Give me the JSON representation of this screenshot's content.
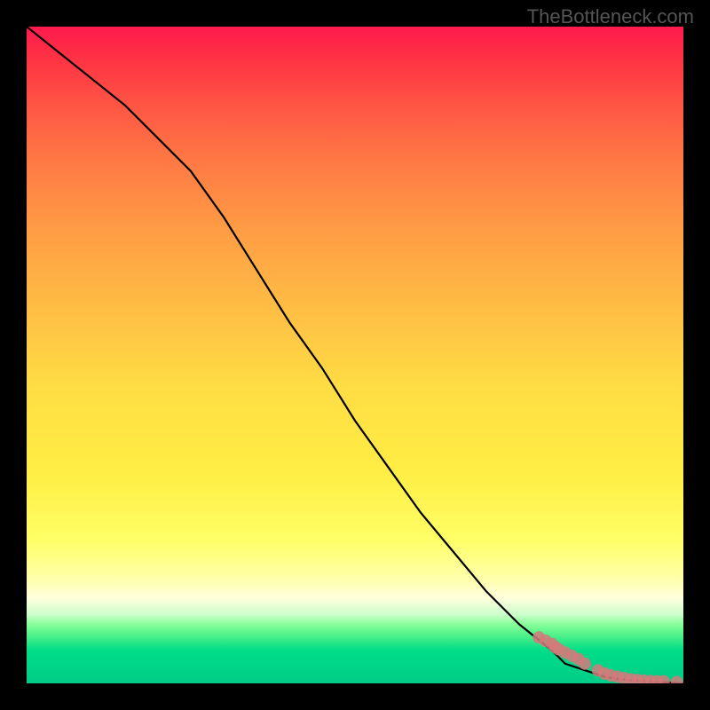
{
  "watermark": "TheBottleneck.com",
  "chart_data": {
    "type": "line",
    "title": "",
    "xlabel": "",
    "ylabel": "",
    "xlim": [
      0,
      100
    ],
    "ylim": [
      0,
      100
    ],
    "grid": false,
    "legend": false,
    "series": [
      {
        "name": "curve",
        "style": "line",
        "color": "#000000",
        "x": [
          0,
          5,
          10,
          15,
          20,
          25,
          30,
          35,
          40,
          45,
          50,
          55,
          60,
          65,
          70,
          75,
          80,
          82,
          85,
          88,
          90,
          92,
          95,
          100
        ],
        "values": [
          100,
          96,
          92,
          88,
          83,
          78,
          71,
          63,
          55,
          48,
          40,
          33,
          26,
          20,
          14,
          9,
          5,
          3,
          2,
          1,
          0.7,
          0.5,
          0.3,
          0
        ]
      },
      {
        "name": "markers",
        "style": "scatter",
        "color": "#d47a7a",
        "x": [
          78,
          79,
          80,
          80.5,
          81,
          82,
          83,
          84,
          85,
          87,
          88,
          89,
          90,
          91,
          92,
          93,
          94,
          95,
          96,
          97,
          99
        ],
        "values": [
          7,
          6.5,
          6,
          5.5,
          5.2,
          4.7,
          4.2,
          3.7,
          3,
          2,
          1.5,
          1.2,
          1,
          0.8,
          0.6,
          0.5,
          0.4,
          0.35,
          0.3,
          0.3,
          0.2
        ]
      }
    ]
  }
}
